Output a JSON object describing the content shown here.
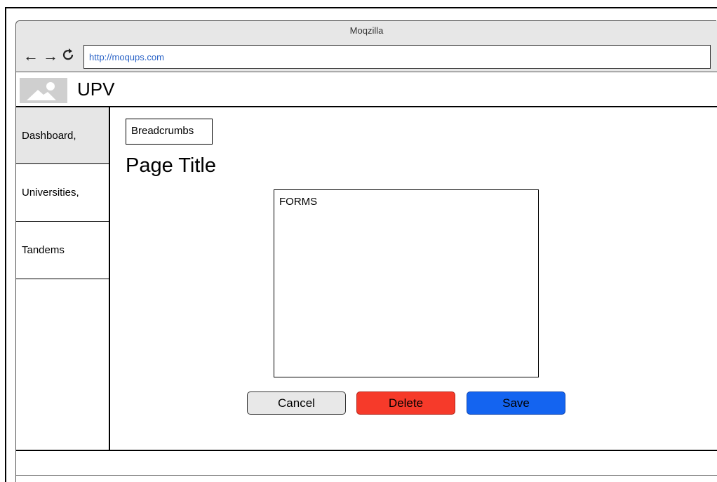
{
  "browser": {
    "window_title": "Moqzilla",
    "back_icon": "arrow-left",
    "forward_icon": "arrow-right",
    "reload_icon": "reload",
    "url": "http://moqups.com"
  },
  "header": {
    "logo_icon": "image-placeholder",
    "title": "UPV"
  },
  "sidebar": {
    "items": [
      {
        "label": "Dashboard,",
        "active": true
      },
      {
        "label": "Universities,",
        "active": false
      },
      {
        "label": "Tandems",
        "active": false
      }
    ]
  },
  "main": {
    "breadcrumbs": "Breadcrumbs",
    "page_title": "Page Title",
    "forms_label": "FORMS",
    "buttons": {
      "cancel": "Cancel",
      "delete": "Delete",
      "save": "Save"
    }
  },
  "colors": {
    "delete": "#f63a2a",
    "save": "#1464f0",
    "cancel": "#e8e8e8",
    "url_text": "#2a63c7",
    "active_sidebar": "#e6e6e6"
  }
}
